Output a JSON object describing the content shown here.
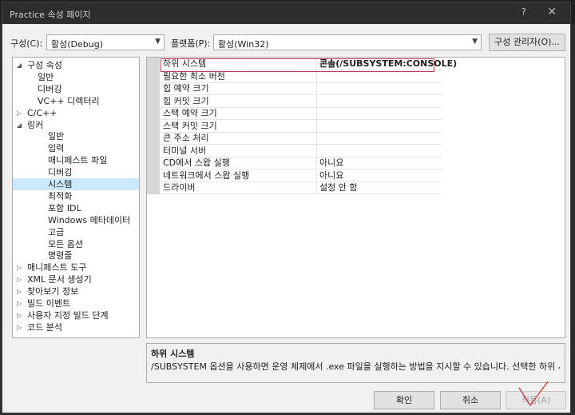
{
  "window": {
    "title": "Practice 속성 페이지",
    "help_glyph": "?",
    "close_glyph": "✕"
  },
  "toolbar": {
    "config_label": "구성(C):",
    "config_value": "활성(Debug)",
    "platform_label": "플랫폼(P):",
    "platform_value": "활성(Win32)",
    "config_manager_label": "구성 관리자(O)..."
  },
  "tree": {
    "items": [
      {
        "label": "구성 속성",
        "expander": "◢"
      },
      {
        "label": "일반"
      },
      {
        "label": "디버깅"
      },
      {
        "label": "VC++ 디렉터리"
      },
      {
        "label": "C/C++",
        "expander": "▷"
      },
      {
        "label": "링커",
        "expander": "◢"
      },
      {
        "label": "일반"
      },
      {
        "label": "입력"
      },
      {
        "label": "매니페스트 파일"
      },
      {
        "label": "디버깅"
      },
      {
        "label": "시스템",
        "selected": true
      },
      {
        "label": "최적화"
      },
      {
        "label": "포함 IDL"
      },
      {
        "label": "Windows 메타데이터"
      },
      {
        "label": "고급"
      },
      {
        "label": "모든 옵션"
      },
      {
        "label": "명령줄"
      },
      {
        "label": "매니페스트 도구",
        "expander": "▷"
      },
      {
        "label": "XML 문서 생성기",
        "expander": "▷"
      },
      {
        "label": "찾아보기 정보",
        "expander": "▷"
      },
      {
        "label": "빌드 이벤트",
        "expander": "▷"
      },
      {
        "label": "사용자 지정 빌드 단계",
        "expander": "▷"
      },
      {
        "label": "코드 분석",
        "expander": "▷"
      }
    ]
  },
  "properties": {
    "rows": [
      {
        "name": "하위 시스템",
        "value": "콘솔(/SUBSYSTEM:CONSOLE)"
      },
      {
        "name": "필요한 최소 버전",
        "value": ""
      },
      {
        "name": "힙 예약 크기",
        "value": ""
      },
      {
        "name": "힙 커밋 크기",
        "value": ""
      },
      {
        "name": "스택 예약 크기",
        "value": ""
      },
      {
        "name": "스택 커밋 크기",
        "value": ""
      },
      {
        "name": "큰 주소 처리",
        "value": ""
      },
      {
        "name": "터미널 서버",
        "value": ""
      },
      {
        "name": "CD에서 스왑 실행",
        "value": "아니요"
      },
      {
        "name": "네트워크에서 스왑 실행",
        "value": "아니요"
      },
      {
        "name": "드라이버",
        "value": "설정 안 함"
      }
    ]
  },
  "description": {
    "title": "하위 시스템",
    "text": "/SUBSYSTEM 옵션을 사용하면 운영 체제에서 .exe 파일을 실행하는 방법을 지시할 수 있습니다. 선택한 하위 시스..."
  },
  "buttons": {
    "ok": "확인",
    "cancel": "취소",
    "apply": "적용(A)"
  },
  "colors": {
    "selection": "#cce8ff",
    "highlight_border": "#c23a4f"
  }
}
